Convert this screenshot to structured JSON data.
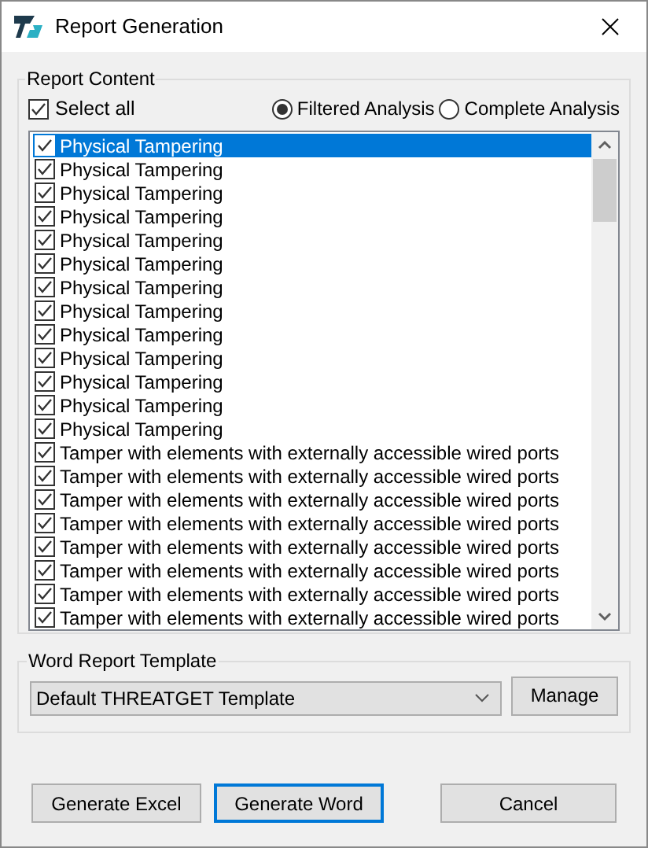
{
  "window": {
    "title": "Report Generation"
  },
  "report_content": {
    "label": "Report Content",
    "select_all": {
      "label": "Select all",
      "checked": true
    },
    "analysis_options": [
      {
        "label": "Filtered Analysis",
        "selected": true
      },
      {
        "label": "Complete Analysis",
        "selected": false
      }
    ],
    "items": [
      {
        "label": "Physical Tampering",
        "checked": true,
        "selected": true
      },
      {
        "label": "Physical Tampering",
        "checked": true,
        "selected": false
      },
      {
        "label": "Physical Tampering",
        "checked": true,
        "selected": false
      },
      {
        "label": "Physical Tampering",
        "checked": true,
        "selected": false
      },
      {
        "label": "Physical Tampering",
        "checked": true,
        "selected": false
      },
      {
        "label": "Physical Tampering",
        "checked": true,
        "selected": false
      },
      {
        "label": "Physical Tampering",
        "checked": true,
        "selected": false
      },
      {
        "label": "Physical Tampering",
        "checked": true,
        "selected": false
      },
      {
        "label": "Physical Tampering",
        "checked": true,
        "selected": false
      },
      {
        "label": "Physical Tampering",
        "checked": true,
        "selected": false
      },
      {
        "label": "Physical Tampering",
        "checked": true,
        "selected": false
      },
      {
        "label": "Physical Tampering",
        "checked": true,
        "selected": false
      },
      {
        "label": "Physical Tampering",
        "checked": true,
        "selected": false
      },
      {
        "label": "Tamper with elements with externally accessible wired ports",
        "checked": true,
        "selected": false
      },
      {
        "label": "Tamper with elements with externally accessible wired ports",
        "checked": true,
        "selected": false
      },
      {
        "label": "Tamper with elements with externally accessible wired ports",
        "checked": true,
        "selected": false
      },
      {
        "label": "Tamper with elements with externally accessible wired ports",
        "checked": true,
        "selected": false
      },
      {
        "label": "Tamper with elements with externally accessible wired ports",
        "checked": true,
        "selected": false
      },
      {
        "label": "Tamper with elements with externally accessible wired ports",
        "checked": true,
        "selected": false
      },
      {
        "label": "Tamper with elements with externally accessible wired ports",
        "checked": true,
        "selected": false
      },
      {
        "label": "Tamper with elements with externally accessible wired ports",
        "checked": true,
        "selected": false
      }
    ]
  },
  "word_template": {
    "label": "Word Report Template",
    "value": "Default THREATGET Template",
    "manage_button": "Manage"
  },
  "buttons": [
    {
      "label": "Generate Excel",
      "selected": false
    },
    {
      "label": "Generate Word",
      "selected": true
    },
    {
      "label": "Cancel",
      "selected": false
    }
  ]
}
